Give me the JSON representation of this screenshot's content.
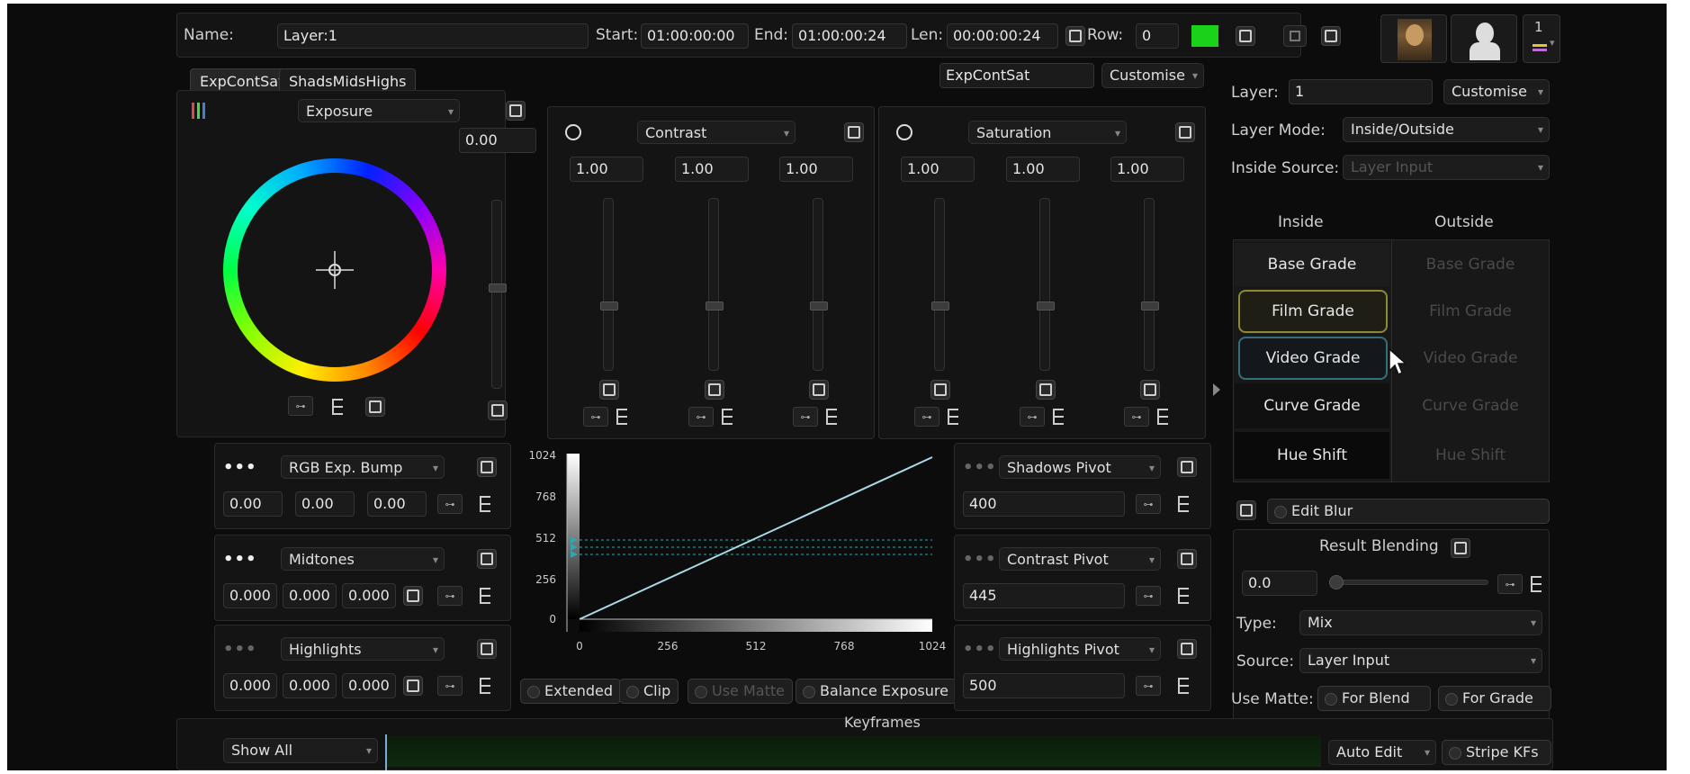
{
  "top_bar": {
    "name_label": "Name:",
    "name_value": "Layer:1",
    "start_label": "Start:",
    "start_value": "01:00:00:00",
    "end_label": "End:",
    "end_value": "01:00:00:24",
    "len_label": "Len:",
    "len_value": "00:00:00:24",
    "row_label": "Row:",
    "row_value": "0",
    "color_swatch": "#19d219",
    "counter": "1"
  },
  "tabs": [
    "ExpContSat",
    "ShadsMidsHighs"
  ],
  "preset_field": "ExpContSat",
  "customise_label": "Customise",
  "exposure": {
    "dropdown": "Exposure",
    "value": "0.00"
  },
  "contrast": {
    "dropdown": "Contrast",
    "values": [
      "1.00",
      "1.00",
      "1.00"
    ]
  },
  "saturation": {
    "dropdown": "Saturation",
    "values": [
      "1.00",
      "1.00",
      "1.00"
    ]
  },
  "rgb_bump": {
    "dropdown": "RGB Exp. Bump",
    "values": [
      "0.00",
      "0.00",
      "0.00"
    ]
  },
  "midtones": {
    "dropdown": "Midtones",
    "values": [
      "0.000",
      "0.000",
      "0.000"
    ]
  },
  "highlights": {
    "dropdown": "Highlights",
    "values": [
      "0.000",
      "0.000",
      "0.000"
    ]
  },
  "curve": {
    "y_ticks": [
      "1024",
      "768",
      "512",
      "256",
      "0"
    ],
    "x_ticks": [
      "0",
      "256",
      "512",
      "768",
      "1024"
    ]
  },
  "curve_options": {
    "extended": "Extended",
    "clip": "Clip",
    "use_matte": "Use Matte",
    "balance": "Balance Exposure"
  },
  "shadows_pivot": {
    "dropdown": "Shadows Pivot",
    "value": "400"
  },
  "contrast_pivot": {
    "dropdown": "Contrast Pivot",
    "value": "445"
  },
  "highlights_pivot": {
    "dropdown": "Highlights Pivot",
    "value": "500"
  },
  "right_panel": {
    "layer_label": "Layer:",
    "layer_value": "1",
    "customise": "Customise",
    "layer_mode_label": "Layer Mode:",
    "layer_mode_value": "Inside/Outside",
    "inside_source_label": "Inside Source:",
    "inside_source_value": "Layer Input",
    "inside_header": "Inside",
    "outside_header": "Outside",
    "grades": [
      "Base Grade",
      "Film Grade",
      "Video Grade",
      "Curve Grade",
      "Hue Shift"
    ],
    "edit_blur": "Edit Blur",
    "result_blending": "Result Blending",
    "blend_value": "0.0",
    "type_label": "Type:",
    "type_value": "Mix",
    "source_label": "Source:",
    "source_value": "Layer Input",
    "use_matte_label": "Use Matte:",
    "for_blend": "For Blend",
    "for_grade": "For Grade"
  },
  "keyframes": {
    "title": "Keyframes",
    "show_all": "Show All",
    "auto_edit": "Auto Edit",
    "stripe_kfs": "Stripe KFs"
  }
}
